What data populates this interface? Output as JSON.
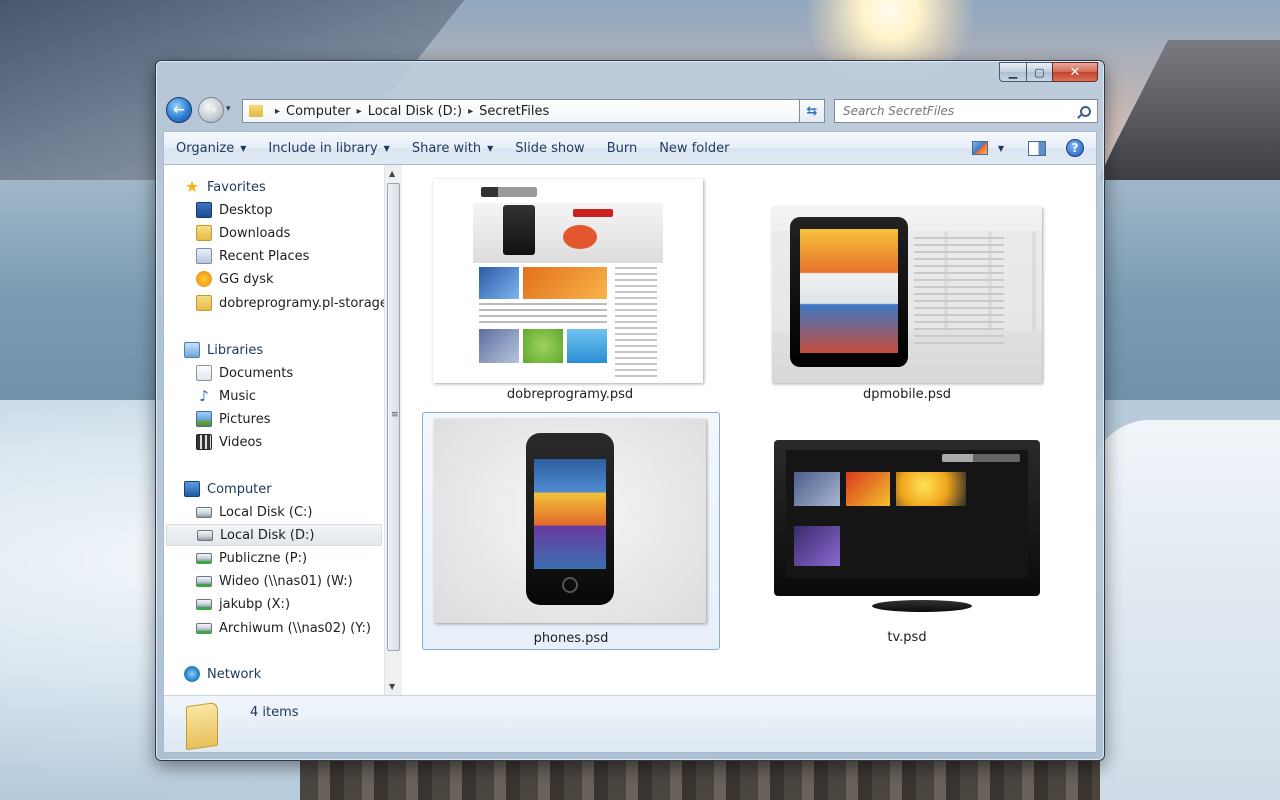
{
  "window": {
    "caption_buttons": {
      "minimize": "▁",
      "maximize": "▢",
      "close": "✕"
    }
  },
  "navigation": {
    "back_glyph": "←",
    "forward_glyph": "→",
    "history_glyph": "▾",
    "breadcrumb": [
      "Computer",
      "Local Disk (D:)",
      "SecretFiles"
    ],
    "breadcrumb_separator": "▸",
    "address_dropdown_glyph": "▾",
    "refresh_glyph": "⇆",
    "search_placeholder": "Search SecretFiles"
  },
  "command_bar": {
    "items": [
      {
        "label": "Organize",
        "has_dropdown": true
      },
      {
        "label": "Include in library",
        "has_dropdown": true
      },
      {
        "label": "Share with",
        "has_dropdown": true
      },
      {
        "label": "Slide show",
        "has_dropdown": false
      },
      {
        "label": "Burn",
        "has_dropdown": false
      },
      {
        "label": "New folder",
        "has_dropdown": false
      }
    ],
    "dropdown_glyph": "▼",
    "help_glyph": "?"
  },
  "nav_pane": {
    "favorites": {
      "label": "Favorites",
      "items": [
        "Desktop",
        "Downloads",
        "Recent Places",
        "GG dysk",
        "dobreprogramy.pl-storage"
      ]
    },
    "libraries": {
      "label": "Libraries",
      "items": [
        "Documents",
        "Music",
        "Pictures",
        "Videos"
      ]
    },
    "computer": {
      "label": "Computer",
      "items": [
        "Local Disk (C:)",
        "Local Disk (D:)",
        "Publiczne (P:)",
        "Wideo (\\\\nas01) (W:)",
        "jakubp (X:)",
        "Archiwum (\\\\nas02) (Y:)"
      ],
      "selected": "Local Disk (D:)"
    },
    "network": {
      "label": "Network"
    },
    "glyphs": {
      "star": "★",
      "music": "♪",
      "scroll_up": "▲",
      "scroll_down": "▼",
      "grip": "≡"
    }
  },
  "files": [
    {
      "name": "dobreprogramy.psd",
      "selected": false
    },
    {
      "name": "dpmobile.psd",
      "selected": false
    },
    {
      "name": "phones.psd",
      "selected": true
    },
    {
      "name": "tv.psd",
      "selected": false
    }
  ],
  "status_bar": {
    "item_count": "4 items"
  }
}
